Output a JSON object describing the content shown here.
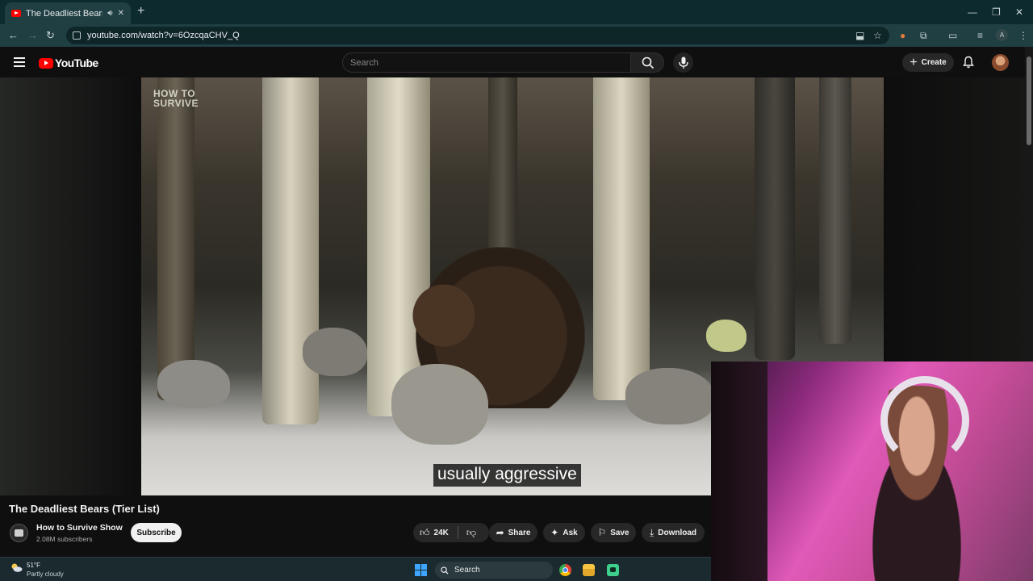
{
  "browser": {
    "tab_title": "The Deadliest Bears (Tier List)",
    "tab_title_short": "The Deadliest Bears (Tier Li",
    "new_tab_icon": "plus-icon",
    "url": "youtube.com/watch?v=6OzcqaCHV_Q",
    "profile_initial": "A"
  },
  "youtube": {
    "logo_text": "YouTube",
    "search_placeholder": "Search",
    "create_label": "Create"
  },
  "video": {
    "watermark_line1": "HOW TO",
    "watermark_line2": "SURVIVE",
    "caption": "usually aggressive",
    "title": "The Deadliest Bears (Tier List)"
  },
  "channel": {
    "name": "How to Survive Show",
    "subscribers": "2.08M subscribers",
    "subscribe_label": "Subscribe"
  },
  "actions": {
    "likes": "24K",
    "share": "Share",
    "ask": "Ask",
    "save": "Save",
    "download": "Download"
  },
  "taskbar": {
    "temperature": "51°F",
    "weather": "Partly cloudy",
    "search_label": "Search"
  },
  "colors": {
    "brand_red": "#ff0000",
    "chrome_frame": "#0d2a2e",
    "chrome_toolbar": "#1f3f43",
    "page_bg": "#0f0f0f",
    "pill_bg": "#272727"
  }
}
